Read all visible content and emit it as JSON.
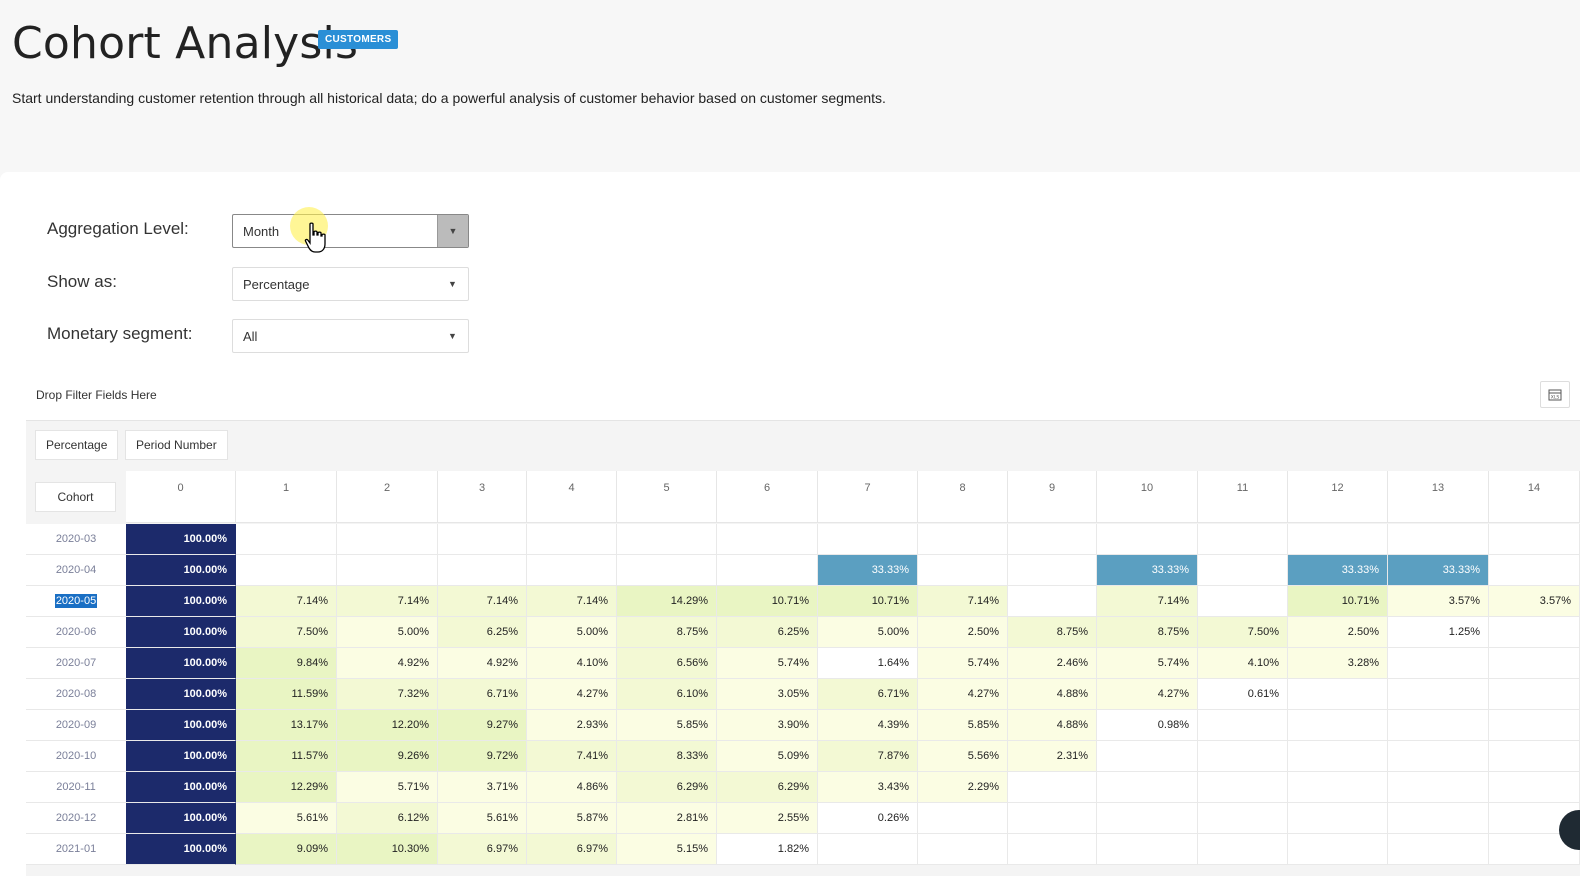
{
  "header": {
    "title": "Cohort Analysis",
    "badge": "CUSTOMERS",
    "subtitle": "Start understanding customer retention through all historical data; do a powerful analysis of customer behavior based on customer segments."
  },
  "controls": {
    "aggregation": {
      "label": "Aggregation Level:",
      "value": "Month"
    },
    "show_as": {
      "label": "Show as:",
      "value": "Percentage"
    },
    "monetary": {
      "label": "Monetary segment:",
      "value": "All"
    }
  },
  "pivot": {
    "drop_filter": "Drop Filter Fields Here",
    "export_icon": "xlsx-export-icon",
    "value_chip": "Percentage",
    "column_chip": "Period Number",
    "row_chip": "Cohort",
    "columns": [
      "0",
      "1",
      "2",
      "3",
      "4",
      "5",
      "6",
      "7",
      "8",
      "9",
      "10",
      "11",
      "12",
      "13",
      "14"
    ],
    "rows": [
      {
        "cohort": "2020-03",
        "values": [
          "100.00%",
          "",
          "",
          "",
          "",
          "",
          "",
          "",
          "",
          "",
          "",
          "",
          "",
          "",
          ""
        ]
      },
      {
        "cohort": "2020-04",
        "values": [
          "100.00%",
          "",
          "",
          "",
          "",
          "",
          "",
          "33.33%",
          "",
          "",
          "33.33%",
          "",
          "33.33%",
          "33.33%",
          ""
        ]
      },
      {
        "cohort": "2020-05",
        "values": [
          "100.00%",
          "7.14%",
          "7.14%",
          "7.14%",
          "7.14%",
          "14.29%",
          "10.71%",
          "10.71%",
          "7.14%",
          "",
          "7.14%",
          "",
          "10.71%",
          "3.57%",
          "3.57%"
        ],
        "selected": true
      },
      {
        "cohort": "2020-06",
        "values": [
          "100.00%",
          "7.50%",
          "5.00%",
          "6.25%",
          "5.00%",
          "8.75%",
          "6.25%",
          "5.00%",
          "2.50%",
          "8.75%",
          "8.75%",
          "7.50%",
          "2.50%",
          "1.25%",
          ""
        ]
      },
      {
        "cohort": "2020-07",
        "values": [
          "100.00%",
          "9.84%",
          "4.92%",
          "4.92%",
          "4.10%",
          "6.56%",
          "5.74%",
          "1.64%",
          "5.74%",
          "2.46%",
          "5.74%",
          "4.10%",
          "3.28%",
          "",
          ""
        ]
      },
      {
        "cohort": "2020-08",
        "values": [
          "100.00%",
          "11.59%",
          "7.32%",
          "6.71%",
          "4.27%",
          "6.10%",
          "3.05%",
          "6.71%",
          "4.27%",
          "4.88%",
          "4.27%",
          "0.61%",
          "",
          "",
          ""
        ]
      },
      {
        "cohort": "2020-09",
        "values": [
          "100.00%",
          "13.17%",
          "12.20%",
          "9.27%",
          "2.93%",
          "5.85%",
          "3.90%",
          "4.39%",
          "5.85%",
          "4.88%",
          "0.98%",
          "",
          "",
          "",
          ""
        ]
      },
      {
        "cohort": "2020-10",
        "values": [
          "100.00%",
          "11.57%",
          "9.26%",
          "9.72%",
          "7.41%",
          "8.33%",
          "5.09%",
          "7.87%",
          "5.56%",
          "2.31%",
          "",
          "",
          "",
          "",
          ""
        ]
      },
      {
        "cohort": "2020-11",
        "values": [
          "100.00%",
          "12.29%",
          "5.71%",
          "3.71%",
          "4.86%",
          "6.29%",
          "6.29%",
          "3.43%",
          "2.29%",
          "",
          "",
          "",
          "",
          "",
          ""
        ]
      },
      {
        "cohort": "2020-12",
        "values": [
          "100.00%",
          "5.61%",
          "6.12%",
          "5.61%",
          "5.87%",
          "2.81%",
          "2.55%",
          "0.26%",
          "",
          "",
          "",
          "",
          "",
          "",
          ""
        ]
      },
      {
        "cohort": "2021-01",
        "values": [
          "100.00%",
          "9.09%",
          "10.30%",
          "6.97%",
          "6.97%",
          "5.15%",
          "1.82%",
          "",
          "",
          "",
          "",
          "",
          "",
          "",
          ""
        ]
      }
    ]
  },
  "colors": {
    "first_col": "#1c2a6b",
    "highlight": "#5b9fc1",
    "scale": [
      "#ffffff",
      "#fbfde3",
      "#f3f9d4",
      "#e9f5c3"
    ]
  }
}
